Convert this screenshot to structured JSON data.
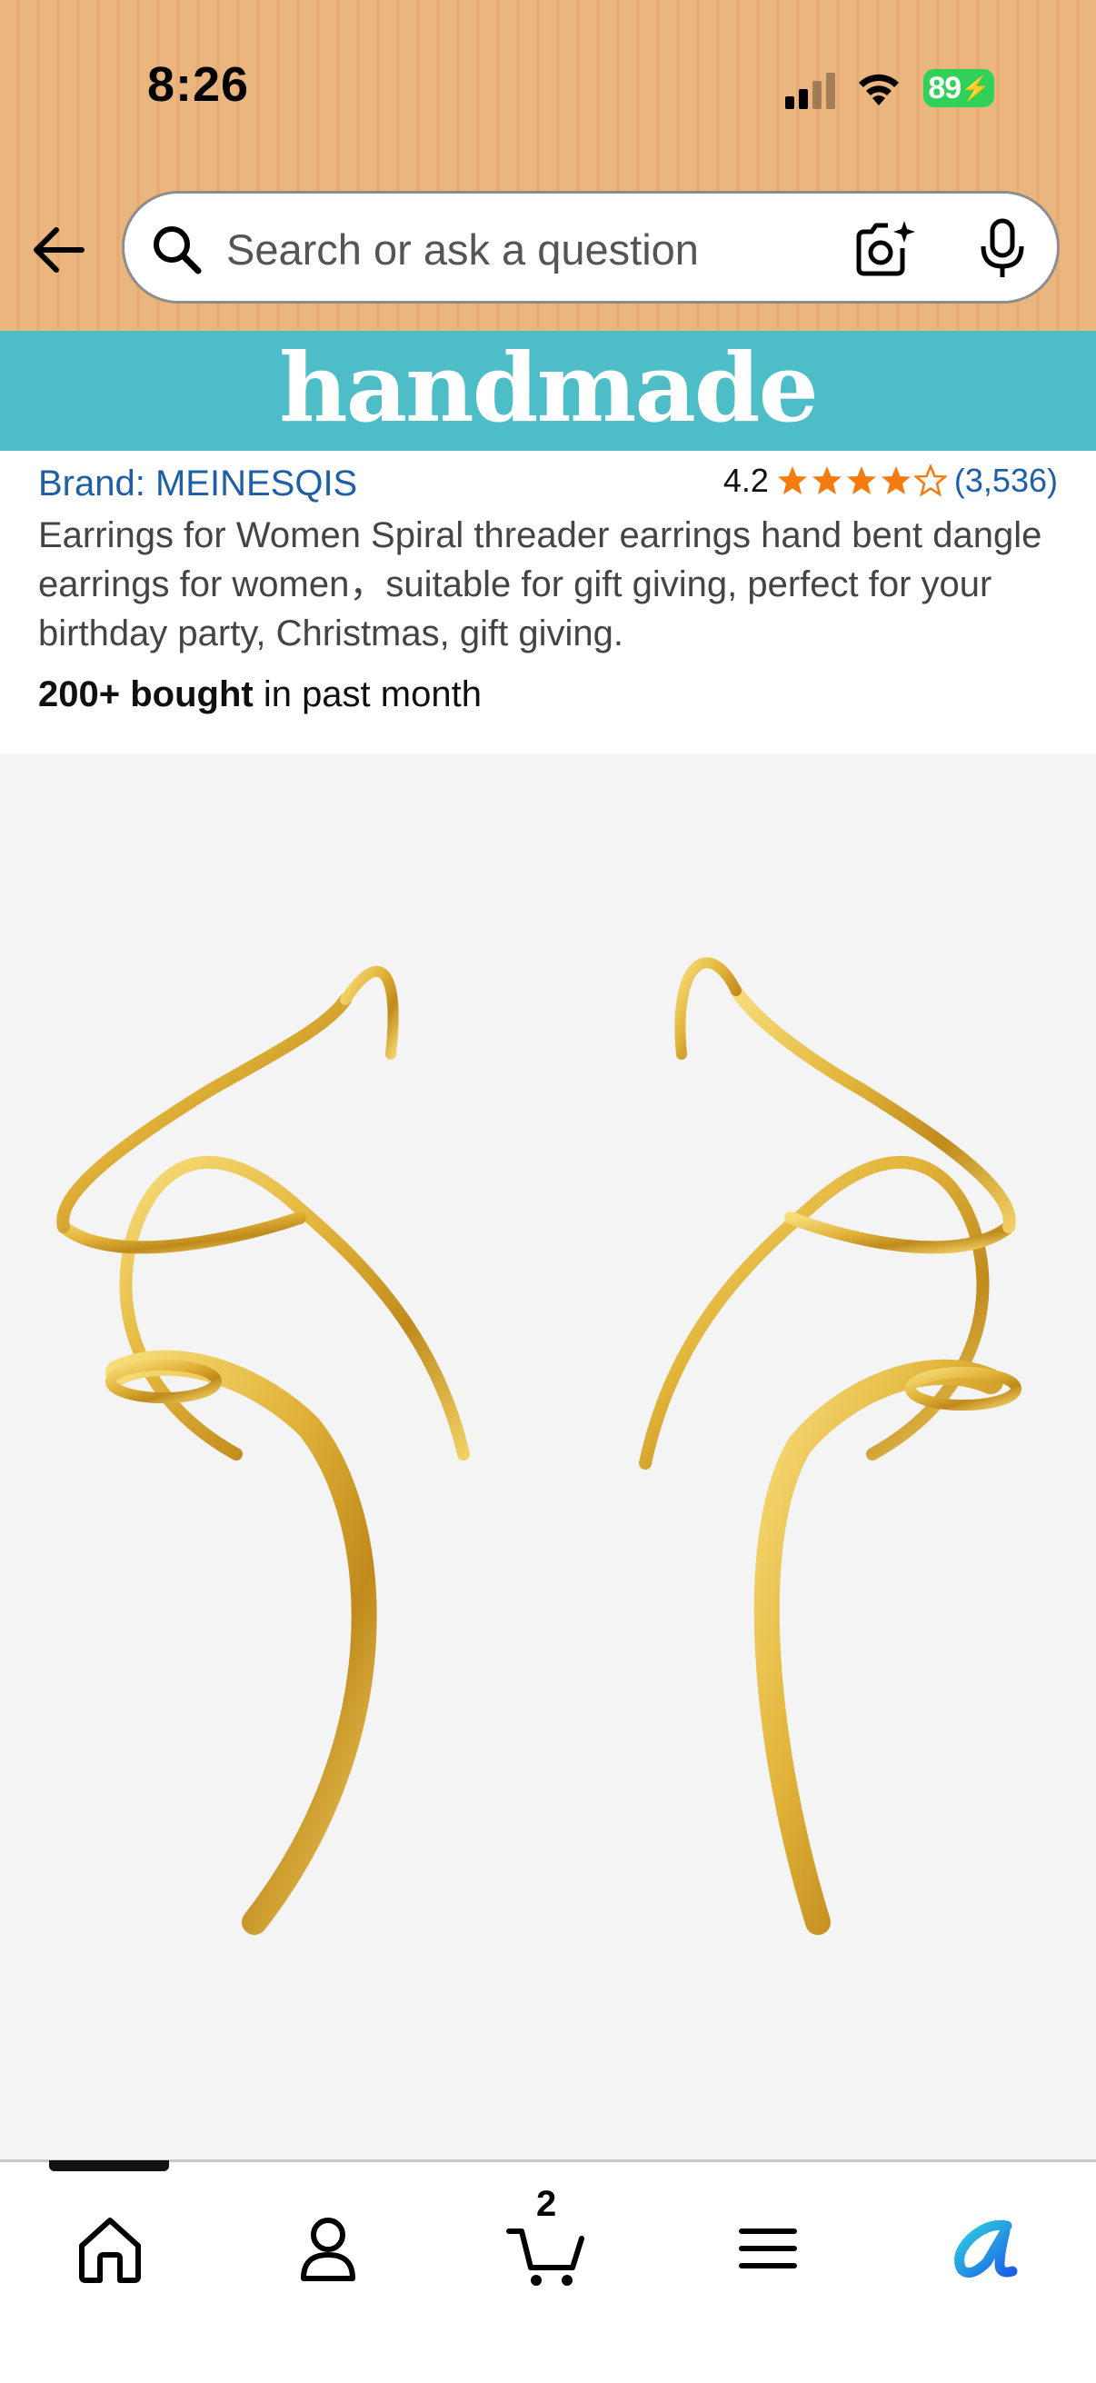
{
  "status_bar": {
    "time": "8:26",
    "battery": "89"
  },
  "search": {
    "placeholder": "Search or ask a question"
  },
  "banner": {
    "text": "handmade",
    "color": "#4dbdc8"
  },
  "product": {
    "brand": "Brand: MEINESQIS",
    "rating": "4.2",
    "rating_stars": 4.2,
    "review_count": "(3,536)",
    "title": "Earrings for Women Spiral threader earrings hand bent dangle earrings for women，suitable for gift giving, perfect for your birthday party, Christmas, gift giving.",
    "bought_bold": "200+ bought",
    "bought_rest": " in past month"
  },
  "bottom_nav": {
    "items": [
      "home-icon",
      "account-icon",
      "cart-icon",
      "menu-icon",
      "rufus-icon"
    ],
    "cart_count": "2",
    "active_index": 0
  },
  "colors": {
    "header_bg": "#ebb57e",
    "link": "#1e5fa8",
    "star": "#f47c0f",
    "gold": "#e2b43a"
  }
}
